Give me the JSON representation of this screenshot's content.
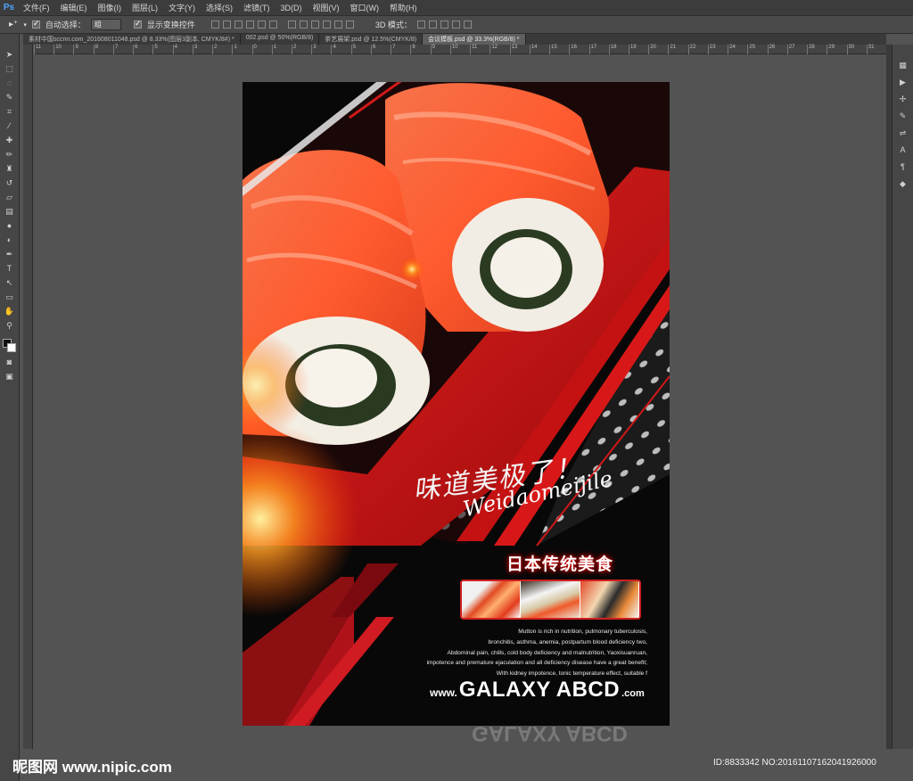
{
  "app": {
    "logo": "Ps",
    "menu": [
      "文件(F)",
      "编辑(E)",
      "图像(I)",
      "图层(L)",
      "文字(Y)",
      "选择(S)",
      "滤镜(T)",
      "3D(D)",
      "视图(V)",
      "窗口(W)",
      "帮助(H)"
    ]
  },
  "options_bar": {
    "auto_select_label": "自动选择：",
    "auto_select_value": "组",
    "show_transform_label": "显示变换控件",
    "mode_3d_label": "3D 模式："
  },
  "tabs": [
    {
      "label": "素材中国sccnn.com_201608011048.psd @ 8.33%(图层3副本, CMYK/8#) *",
      "active": false
    },
    {
      "label": "002.psd @ 50%(RGB/8)",
      "active": false
    },
    {
      "label": "茶艺展架.psd @ 12.5%(CMYK/8)",
      "active": false
    },
    {
      "label": "会议模板.psd @ 33.3%(RGB/8) *",
      "active": true
    }
  ],
  "ruler": {
    "labels": [
      "11",
      "10",
      "9",
      "8",
      "7",
      "6",
      "5",
      "4",
      "3",
      "2",
      "1",
      "0",
      "1",
      "2",
      "3",
      "4",
      "5",
      "6",
      "7",
      "8",
      "9",
      "10",
      "11",
      "12",
      "13",
      "14",
      "15",
      "16",
      "17",
      "18",
      "19",
      "20",
      "21",
      "22",
      "23",
      "24",
      "25",
      "26",
      "27",
      "28",
      "29",
      "30",
      "31"
    ]
  },
  "tools": [
    "move",
    "marquee",
    "lasso",
    "quick-select",
    "crop",
    "eyedropper",
    "healing",
    "brush",
    "clone-stamp",
    "history-brush",
    "eraser",
    "gradient",
    "blur",
    "dodge",
    "pen",
    "type",
    "path-select",
    "shape",
    "hand",
    "zoom"
  ],
  "poster": {
    "calligraphy_cn": "味道美极了！",
    "calligraphy_en": "Weidaomeijile",
    "title": "日本传统美食",
    "description": [
      "Mutton is rich in nutrition, pulmonary tuberculosis,",
      "bronchitis, asthma, anemia, postpartum blood deficiency two,",
      "Abdominal pain, chills, cold body deficiency and malnutrition, Yaoxisuanruan,",
      "impotence and premature ejaculation and all deficiency disease have a great benefit;",
      "With kidney impotence, tonic temperature effect, suitable f"
    ],
    "website_prefix": "www.",
    "website_main": "GALAXY ABCD",
    "website_suffix": ".com",
    "colors": {
      "accent_red": "#d01818",
      "background": "#080808"
    }
  },
  "watermark": {
    "logo_text": "昵图网 www.nipic.com",
    "id_text": "ID:8833342 NO:20161107162041926000"
  }
}
